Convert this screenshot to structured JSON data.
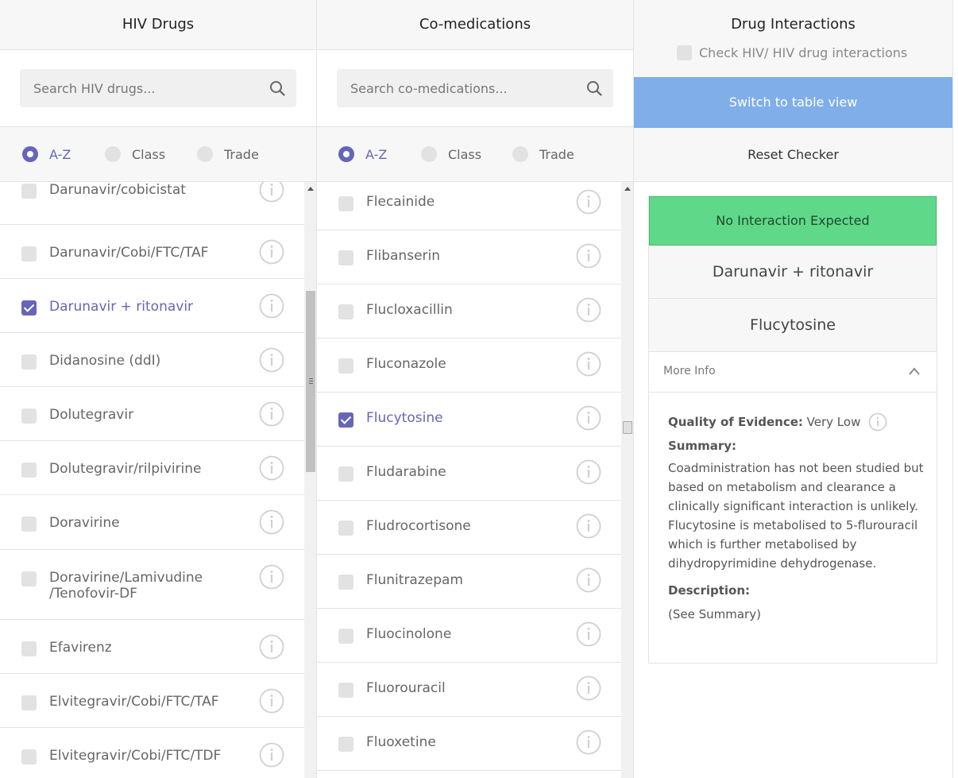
{
  "hiv": {
    "title": "HIV Drugs",
    "search_placeholder": "Search HIV drugs...",
    "sort_options": [
      "A-Z",
      "Class",
      "Trade"
    ],
    "items": [
      {
        "label": "Darunavir/cobicistat",
        "checked": false
      },
      {
        "label": "Darunavir/Cobi/FTC/TAF",
        "checked": false
      },
      {
        "label": "Darunavir + ritonavir",
        "checked": true
      },
      {
        "label": "Didanosine (ddI)",
        "checked": false
      },
      {
        "label": "Dolutegravir",
        "checked": false
      },
      {
        "label": "Dolutegravir/rilpivirine",
        "checked": false
      },
      {
        "label": "Doravirine",
        "checked": false
      },
      {
        "label": "Doravirine/Lamivudine\n/Tenofovir-DF",
        "checked": false
      },
      {
        "label": "Efavirenz",
        "checked": false
      },
      {
        "label": "Elvitegravir/Cobi/FTC/TAF",
        "checked": false
      },
      {
        "label": "Elvitegravir/Cobi/FTC/TDF",
        "checked": false
      }
    ]
  },
  "comed": {
    "title": "Co-medications",
    "search_placeholder": "Search co-medications...",
    "sort_options": [
      "A-Z",
      "Class",
      "Trade"
    ],
    "items": [
      {
        "label": "Flecainide",
        "checked": false
      },
      {
        "label": "Flibanserin",
        "checked": false
      },
      {
        "label": "Flucloxacillin",
        "checked": false
      },
      {
        "label": "Fluconazole",
        "checked": false
      },
      {
        "label": "Flucytosine",
        "checked": true
      },
      {
        "label": "Fludarabine",
        "checked": false
      },
      {
        "label": "Fludrocortisone",
        "checked": false
      },
      {
        "label": "Flunitrazepam",
        "checked": false
      },
      {
        "label": "Fluocinolone",
        "checked": false
      },
      {
        "label": "Fluorouracil",
        "checked": false
      },
      {
        "label": "Fluoxetine",
        "checked": false
      }
    ]
  },
  "interactions": {
    "title": "Drug Interactions",
    "check_hiv_label": "Check HIV/ HIV drug interactions",
    "switch_label": "Switch to table view",
    "reset_label": "Reset Checker",
    "status": "No Interaction Expected",
    "status_color": "#5fd88a",
    "drug_a": "Darunavir + ritonavir",
    "drug_b": "Flucytosine",
    "more_info_label": "More Info",
    "quality_label": "Quality of Evidence:",
    "quality_value": "Very Low",
    "summary_label": "Summary:",
    "summary_text": "Coadministration has not been studied but based on metabolism and clearance a clinically significant interaction is unlikely. Flucytosine is metabolised to 5-flurouracil which is further metabolised by dihydropyrimidine dehydrogenase.",
    "description_label": "Description:",
    "description_text": "(See Summary)"
  },
  "colors": {
    "accent": "#6566b8",
    "button_blue": "#7faee9"
  }
}
